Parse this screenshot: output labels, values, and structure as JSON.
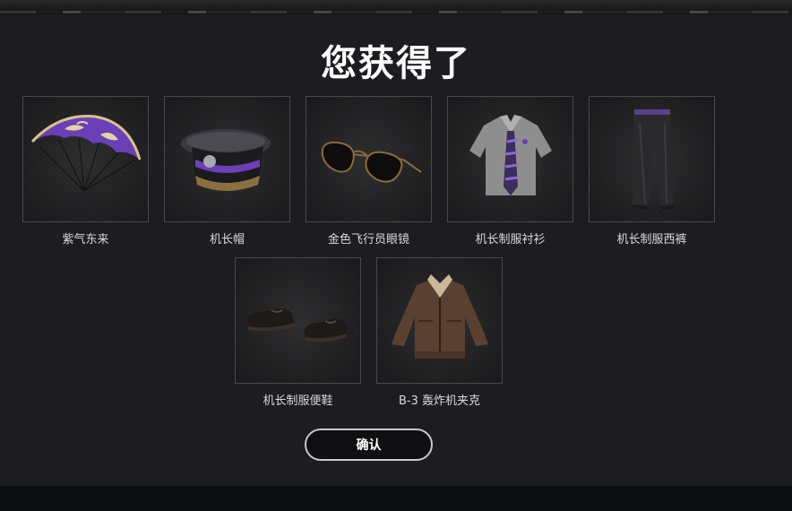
{
  "dialog": {
    "title": "您获得了",
    "confirm_label": "确认"
  },
  "rewards": [
    {
      "name": "紫气东来",
      "icon": "parachute-icon"
    },
    {
      "name": "机长帽",
      "icon": "captain-hat-icon"
    },
    {
      "name": "金色飞行员眼镜",
      "icon": "aviator-sunglasses-icon"
    },
    {
      "name": "机长制服衬衫",
      "icon": "uniform-shirt-icon"
    },
    {
      "name": "机长制服西裤",
      "icon": "uniform-trousers-icon"
    },
    {
      "name": "机长制服便鞋",
      "icon": "uniform-shoes-icon"
    },
    {
      "name": "B-3 轰炸机夹克",
      "icon": "bomber-jacket-icon"
    }
  ],
  "colors": {
    "background": "#1c1c21",
    "tile_border": "#4a4a4e",
    "accent_purple": "#6b3fb5",
    "text": "#d9d9dc"
  }
}
